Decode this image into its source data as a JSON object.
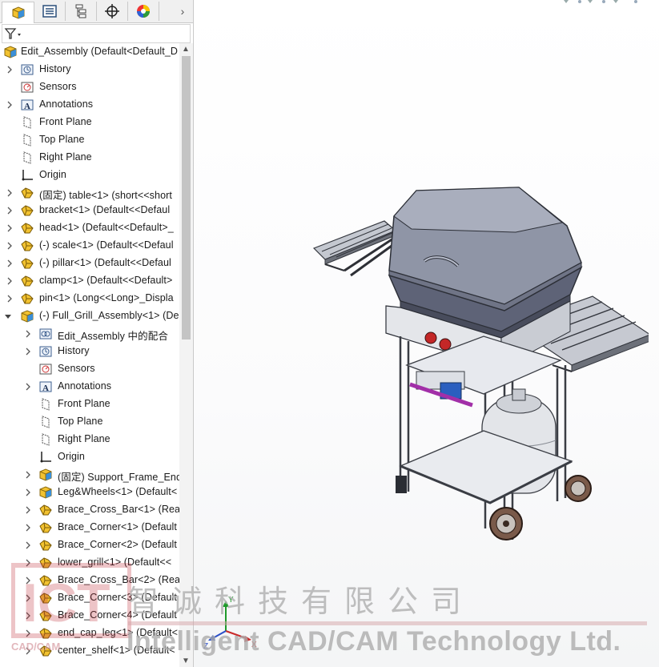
{
  "tabs": [
    {
      "name": "feature-manager-tab",
      "icon": "assembly-tree-icon"
    },
    {
      "name": "property-manager-tab",
      "icon": "property-list-icon"
    },
    {
      "name": "configuration-manager-tab",
      "icon": "configuration-icon"
    },
    {
      "name": "dimxpert-tab",
      "icon": "crosshair-icon"
    },
    {
      "name": "display-manager-tab",
      "icon": "color-wheel-icon"
    }
  ],
  "tree": {
    "root": "Edit_Assembly  (Default<Default_D",
    "items": [
      {
        "label": "History",
        "icon": "history-icon",
        "indent": 0,
        "expander": "collapsed"
      },
      {
        "label": "Sensors",
        "icon": "sensor-icon",
        "indent": 0,
        "expander": "none"
      },
      {
        "label": "Annotations",
        "icon": "annotation-icon",
        "indent": 0,
        "expander": "collapsed"
      },
      {
        "label": "Front Plane",
        "icon": "plane-icon",
        "indent": 0,
        "expander": "none"
      },
      {
        "label": "Top Plane",
        "icon": "plane-icon",
        "indent": 0,
        "expander": "none"
      },
      {
        "label": "Right Plane",
        "icon": "plane-icon",
        "indent": 0,
        "expander": "none"
      },
      {
        "label": "Origin",
        "icon": "origin-icon",
        "indent": 0,
        "expander": "none"
      },
      {
        "label": "(固定) table<1> (short<<short",
        "icon": "part-icon",
        "indent": 0,
        "expander": "collapsed"
      },
      {
        "label": "bracket<1> (Default<<Defaul",
        "icon": "part-icon",
        "indent": 0,
        "expander": "collapsed"
      },
      {
        "label": "head<1> (Default<<Default>_",
        "icon": "part-icon",
        "indent": 0,
        "expander": "collapsed"
      },
      {
        "label": "(-) scale<1> (Default<<Defaul",
        "icon": "part-icon",
        "indent": 0,
        "expander": "collapsed"
      },
      {
        "label": "(-) pillar<1> (Default<<Defaul",
        "icon": "part-icon",
        "indent": 0,
        "expander": "collapsed"
      },
      {
        "label": "clamp<1> (Default<<Default>",
        "icon": "part-icon",
        "indent": 0,
        "expander": "collapsed"
      },
      {
        "label": "pin<1> (Long<<Long>_Displa",
        "icon": "part-icon",
        "indent": 0,
        "expander": "collapsed"
      },
      {
        "label": "(-) Full_Grill_Assembly<1> (De",
        "icon": "assembly-icon",
        "indent": 0,
        "expander": "expanded"
      },
      {
        "label": "Edit_Assembly 中的配合",
        "icon": "mates-icon",
        "indent": 1,
        "expander": "collapsed"
      },
      {
        "label": "History",
        "icon": "history-icon",
        "indent": 1,
        "expander": "collapsed"
      },
      {
        "label": "Sensors",
        "icon": "sensor-icon",
        "indent": 1,
        "expander": "none"
      },
      {
        "label": "Annotations",
        "icon": "annotation-icon",
        "indent": 1,
        "expander": "collapsed"
      },
      {
        "label": "Front Plane",
        "icon": "plane-icon",
        "indent": 1,
        "expander": "none"
      },
      {
        "label": "Top Plane",
        "icon": "plane-icon",
        "indent": 1,
        "expander": "none"
      },
      {
        "label": "Right Plane",
        "icon": "plane-icon",
        "indent": 1,
        "expander": "none"
      },
      {
        "label": "Origin",
        "icon": "origin-icon",
        "indent": 1,
        "expander": "none"
      },
      {
        "label": "(固定) Support_Frame_End",
        "icon": "assembly-icon",
        "indent": 1,
        "expander": "collapsed"
      },
      {
        "label": "Leg&Wheels<1> (Default<",
        "icon": "assembly-icon",
        "indent": 1,
        "expander": "collapsed"
      },
      {
        "label": "Brace_Cross_Bar<1> (Rea",
        "icon": "part-icon",
        "indent": 1,
        "expander": "collapsed"
      },
      {
        "label": "Brace_Corner<1> (Default",
        "icon": "part-icon",
        "indent": 1,
        "expander": "collapsed"
      },
      {
        "label": "Brace_Corner<2> (Default",
        "icon": "part-icon",
        "indent": 1,
        "expander": "collapsed"
      },
      {
        "label": "lower_grill<1> (Default<<",
        "icon": "part-icon",
        "indent": 1,
        "expander": "collapsed"
      },
      {
        "label": "Brace_Cross_Bar<2> (Rea",
        "icon": "part-icon",
        "indent": 1,
        "expander": "collapsed"
      },
      {
        "label": "Brace_Corner<3> (Default",
        "icon": "part-icon",
        "indent": 1,
        "expander": "collapsed"
      },
      {
        "label": "Brace_Corner<4> (Default",
        "icon": "part-icon",
        "indent": 1,
        "expander": "collapsed"
      },
      {
        "label": "end_cap_leg<1> (Default<",
        "icon": "part-icon",
        "indent": 1,
        "expander": "collapsed"
      },
      {
        "label": "center_shelf<1> (Default<",
        "icon": "part-icon",
        "indent": 1,
        "expander": "collapsed"
      }
    ]
  },
  "triad": {
    "x": "X",
    "y": "Y",
    "z": "Z"
  },
  "watermark": {
    "cn": "智诚科技有限公司",
    "en": "Intelligent CAD/CAM Technology Ltd.",
    "logo": "ICT",
    "logo_small": "CAD/CAM"
  },
  "colors": {
    "accent": "#1f6fc8",
    "part": "#f2c230",
    "assembly_blue": "#3a8fd8"
  }
}
